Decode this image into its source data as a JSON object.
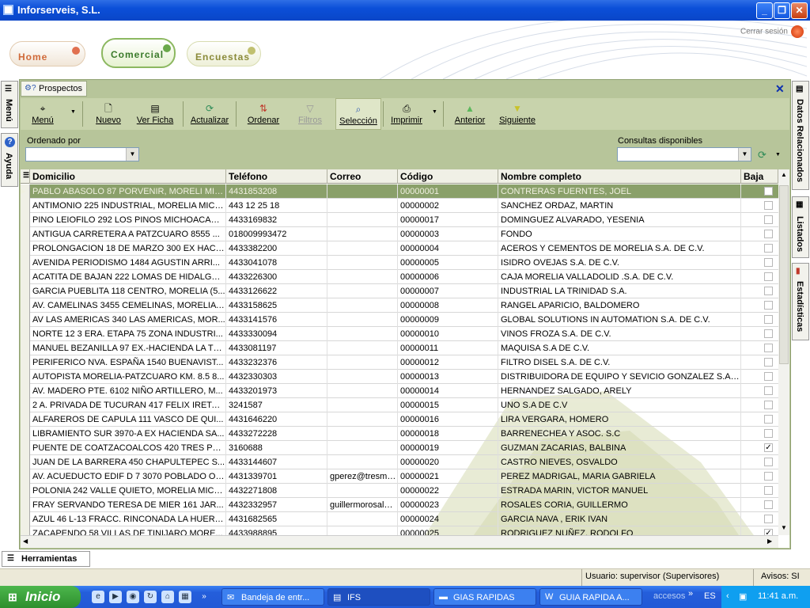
{
  "window": {
    "title": "Inforserveis, S.L."
  },
  "header": {
    "nav": [
      {
        "label": "Home"
      },
      {
        "label": "Comercial"
      },
      {
        "label": "Encuestas"
      }
    ],
    "logout_label": "Cerrar sesión"
  },
  "side_left": {
    "menu_label": "Menú",
    "help_label": "Ayuda"
  },
  "side_right": {
    "related_label": "Datos Relacionados",
    "lists_label": "Listados",
    "stats_label": "Estadísticas"
  },
  "panel": {
    "tab_label": "Prospectos"
  },
  "toolbar": {
    "menu": "Menú",
    "nuevo": "Nuevo",
    "ver_ficha": "Ver Ficha",
    "actualizar": "Actualizar",
    "ordenar": "Ordenar",
    "filtros": "Filtros",
    "seleccion": "Selección",
    "imprimir": "Imprimir",
    "anterior": "Anterior",
    "siguiente": "Siguiente"
  },
  "filters": {
    "order_label": "Ordenado por",
    "order_value": "",
    "queries_label": "Consultas disponibles",
    "queries_value": ""
  },
  "grid": {
    "headers": [
      "Domicilio",
      "Teléfono",
      "Correo",
      "Código",
      "Nombre completo",
      "Baja"
    ],
    "rows": [
      {
        "domicilio": "PABLO ABASOLO 87 PORVENIR, MORELI MIC...",
        "telefono": "4431853208",
        "correo": "",
        "codigo": "00000001",
        "nombre": "CONTRERAS FUERNTES, JOEL",
        "baja": false
      },
      {
        "domicilio": "ANTIMONIO 225 INDUSTRIAL, MORELIA MICH...",
        "telefono": "443 12 25 18",
        "correo": "",
        "codigo": "00000002",
        "nombre": "SANCHEZ ORDAZ, MARTIN",
        "baja": false
      },
      {
        "domicilio": "PINO LEIOFILO 292 LOS PINOS MICHOACAN, ...",
        "telefono": "4433169832",
        "correo": "",
        "codigo": "00000017",
        "nombre": "DOMINGUEZ ALVARADO, YESENIA",
        "baja": false
      },
      {
        "domicilio": "ANTIGUA CARRETERA A PATZCUARO  8555 ...",
        "telefono": "018009993472",
        "correo": "",
        "codigo": "00000003",
        "nombre": "FONDO",
        "baja": false
      },
      {
        "domicilio": "PROLONGACION 18 DE MARZO 300 EX HACIE...",
        "telefono": "4433382200",
        "correo": "",
        "codigo": "00000004",
        "nombre": "ACEROS Y CEMENTOS DE MORELIA S.A. DE C.V.",
        "baja": false
      },
      {
        "domicilio": "AVENIDA  PERIODISMO  1484 AGUSTIN ARRI...",
        "telefono": "4433041078",
        "correo": "",
        "codigo": "00000005",
        "nombre": "ISIDRO OVEJAS S.A. DE C.V.",
        "baja": false
      },
      {
        "domicilio": "ACATITA DE BAJAN  222 LOMAS DE HIDALGO...",
        "telefono": "4433226300",
        "correo": "",
        "codigo": "00000006",
        "nombre": "CAJA MORELIA VALLADOLID .S.A. DE C.V.",
        "baja": false
      },
      {
        "domicilio": "GARCIA PUEBLITA 118 CENTRO, MORELIA (5...",
        "telefono": "4433126622",
        "correo": "",
        "codigo": "00000007",
        "nombre": "INDUSTRIAL LA TRINIDAD S.A.",
        "baja": false
      },
      {
        "domicilio": "AV. CAMELINAS 3455 CEMELINAS, MORELIA (...",
        "telefono": "4433158625",
        "correo": "",
        "codigo": "00000008",
        "nombre": "RANGEL APARICIO, BALDOMERO",
        "baja": false
      },
      {
        "domicilio": "AV LAS AMERICAS  340 LAS AMERICAS, MOR...",
        "telefono": "4433141576",
        "correo": "",
        "codigo": "00000009",
        "nombre": "GLOBAL SOLUTIONS IN AUTOMATION S.A.  DE C.V.",
        "baja": false
      },
      {
        "domicilio": "NORTE 12 3 ERA. ETAPA 75 ZONA INDUSTRI...",
        "telefono": "4433330094",
        "correo": "",
        "codigo": "00000010",
        "nombre": "VINOS FROZA S.A. DE C.V.",
        "baja": false
      },
      {
        "domicilio": "MANUEL BEZANILLA 97 EX.-HACIENDA LA TR...",
        "telefono": "4433081197",
        "correo": "",
        "codigo": "00000011",
        "nombre": "MAQUISA S.A DE C.V.",
        "baja": false
      },
      {
        "domicilio": "PERIFERICO NVA. ESPAÑA  1540 BUENAVIST...",
        "telefono": "4433232376",
        "correo": "",
        "codigo": "00000012",
        "nombre": "FILTRO DISEL S.A. DE C.V.",
        "baja": false
      },
      {
        "domicilio": "AUTOPISTA MORELIA-PATZCUARO KM. 8.5 8...",
        "telefono": "4432330303",
        "correo": "",
        "codigo": "00000013",
        "nombre": "DISTRIBUIDORA DE EQUIPO Y SEVICIO GONZALEZ S.A. ...",
        "baja": false
      },
      {
        "domicilio": "AV. MADERO PTE. 6102 NIÑO ARTILLERO, M...",
        "telefono": "4433201973",
        "correo": "",
        "codigo": "00000014",
        "nombre": "HERNANDEZ SALGADO, ARELY",
        "baja": false
      },
      {
        "domicilio": "2 A. PRIVADA DE TUCURAN 417 FELIX IRETA,...",
        "telefono": "3241587",
        "correo": "",
        "codigo": "00000015",
        "nombre": "UNO S.A DE C.V",
        "baja": false
      },
      {
        "domicilio": "ALFAREROS DE CAPULA 111 VASCO DE QUI...",
        "telefono": "4431646220",
        "correo": "",
        "codigo": "00000016",
        "nombre": "LIRA VERGARA, HOMERO",
        "baja": false
      },
      {
        "domicilio": "LIBRAMIENTO SUR 3970-A EX HACIENDA SA...",
        "telefono": "4433272228",
        "correo": "",
        "codigo": "00000018",
        "nombre": "BARRENECHEA Y ASOC. S.C",
        "baja": false
      },
      {
        "domicilio": "PUENTE DE COATZACOALCOS 420 TRES PU...",
        "telefono": "3160688",
        "correo": "",
        "codigo": "00000019",
        "nombre": "GUZMAN ZACARIAS, BALBINA",
        "baja": true
      },
      {
        "domicilio": "JUAN DE LA BARRERA 450 CHAPULTEPEC S...",
        "telefono": "4433144607",
        "correo": "",
        "codigo": "00000020",
        "nombre": "CASTRO NIEVES, OSVALDO",
        "baja": false
      },
      {
        "domicilio": "AV. ACUEDUCTO EDIF D 7 3070 POBLADO OC...",
        "telefono": "4431339701",
        "correo": "gperez@tresma...",
        "codigo": "00000021",
        "nombre": "PEREZ MADRIGAL, MARIA  GABRIELA",
        "baja": false
      },
      {
        "domicilio": "POLONIA 242 VALLE QUIETO, MORELIA MICH...",
        "telefono": "4432271808",
        "correo": "",
        "codigo": "00000022",
        "nombre": "ESTRADA MARIN, VICTOR MANUEL",
        "baja": false
      },
      {
        "domicilio": "FRAY SERVANDO TERESA DE MIER 161 JAR...",
        "telefono": "4432332957",
        "correo": "guillermorosales...",
        "codigo": "00000023",
        "nombre": "ROSALES CORIA, GUILLERMO",
        "baja": false
      },
      {
        "domicilio": "AZUL 46 L-13 FRACC. RINCONADA LA HUERT...",
        "telefono": "4431682565",
        "correo": "",
        "codigo": "00000024",
        "nombre": "GARCIA  NAVA , ERIK IVAN",
        "baja": false
      },
      {
        "domicilio": "ZACAPENDO  58 VILLAS DE TINIJARO  MORE...",
        "telefono": "4433988895",
        "correo": "",
        "codigo": "00000025",
        "nombre": "RODRIGUEZ NUÑEZ, RODOLFO",
        "baja": true
      }
    ]
  },
  "bottom": {
    "tools_tab": "Herramientas",
    "user": "Usuario: supervisor (Supervisores)",
    "alerts": "Avisos: SI"
  },
  "taskbar": {
    "start": "Inicio",
    "tasks": [
      "Bandeja de entr...",
      "IFS",
      "GIAS RAPIDAS",
      "GUIA RAPIDA A..."
    ],
    "accesos": "accesos",
    "lang": "ES",
    "clock": "11:41 a.m."
  },
  "colors": {
    "panel": "#b7c59a",
    "selected_row": "#8aa06a",
    "titlebar": "#0b4fd8",
    "taskbar": "#245edb",
    "start": "#2d8f2d"
  }
}
